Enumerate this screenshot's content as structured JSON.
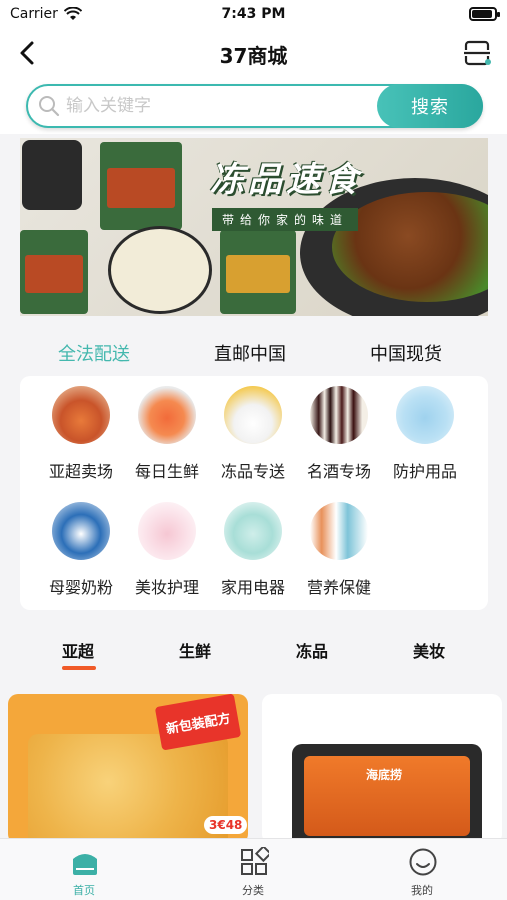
{
  "status_bar": {
    "carrier": "Carrier",
    "time": "7:43 PM"
  },
  "nav": {
    "title": "37商城"
  },
  "search": {
    "placeholder": "输入关键字",
    "button_label": "搜索"
  },
  "banner": {
    "title": "冻品速食",
    "subtitle": "带给你家的味道"
  },
  "top_tabs": [
    {
      "label": "全法配送",
      "active": true
    },
    {
      "label": "直邮中国",
      "active": false
    },
    {
      "label": "中国现货",
      "active": false
    }
  ],
  "categories": [
    {
      "label": "亚超卖场",
      "icon": "asian-market-icon"
    },
    {
      "label": "每日生鲜",
      "icon": "fresh-seafood-icon"
    },
    {
      "label": "冻品专送",
      "icon": "frozen-food-icon"
    },
    {
      "label": "名酒专场",
      "icon": "wine-bottles-icon"
    },
    {
      "label": "防护用品",
      "icon": "face-mask-icon"
    },
    {
      "label": "母婴奶粉",
      "icon": "baby-formula-icon"
    },
    {
      "label": "美妆护理",
      "icon": "cosmetics-icon"
    },
    {
      "label": "家用电器",
      "icon": "kettle-icon"
    },
    {
      "label": "营养保健",
      "icon": "supplements-icon"
    }
  ],
  "product_tabs": [
    {
      "label": "亚超",
      "active": true
    },
    {
      "label": "生鲜",
      "active": false
    },
    {
      "label": "冻品",
      "active": false
    },
    {
      "label": "美妆",
      "active": false
    }
  ],
  "products": [
    {
      "badge": "新包装配方",
      "price_tag": "3€48"
    },
    {
      "brand": "海底捞"
    }
  ],
  "tab_bar": [
    {
      "label": "首页",
      "icon": "home-icon",
      "active": true
    },
    {
      "label": "分类",
      "icon": "category-grid-icon",
      "active": false
    },
    {
      "label": "我的",
      "icon": "profile-icon",
      "active": false
    }
  ],
  "colors": {
    "accent": "#44b8ae",
    "underline": "#f05a28"
  }
}
